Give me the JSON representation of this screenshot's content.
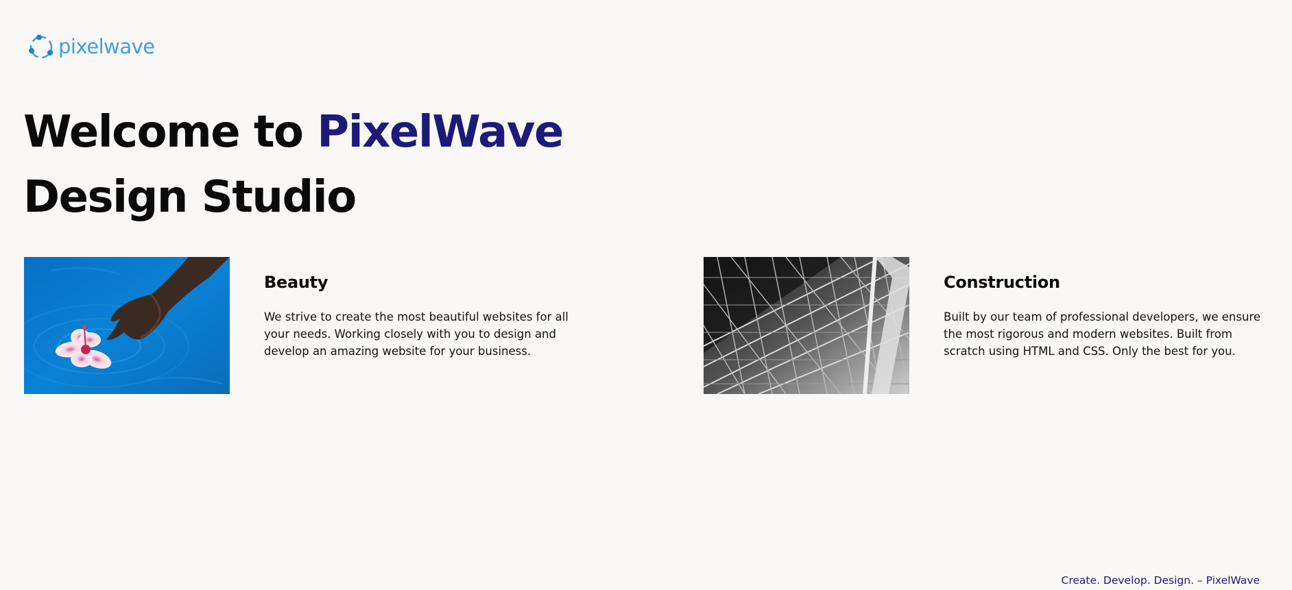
{
  "logo": {
    "text": "pixelwave",
    "icon": "orbit-circle-icon",
    "color": "#3ea0e4"
  },
  "hero": {
    "title_prefix": "Welcome to ",
    "title_accent": "PixelWave",
    "title_line2": "Design Studio",
    "accent_color": "#1d1a78"
  },
  "cards": [
    {
      "title": "Beauty",
      "text": "We strive to create the most beautiful websites for all your needs. Working closely with you to design and develop an amazing website for your business.",
      "image": "hand-touching-flower-in-pool-photo"
    },
    {
      "title": "Construction",
      "text": "Built by our team of professional developers, we ensure the most rigorous and modern websites. Built from scratch using HTML and CSS. Only the best for you.",
      "image": "steel-truss-structure-photo"
    }
  ],
  "footer": {
    "text": "Create. Develop. Design. – PixelWave"
  }
}
